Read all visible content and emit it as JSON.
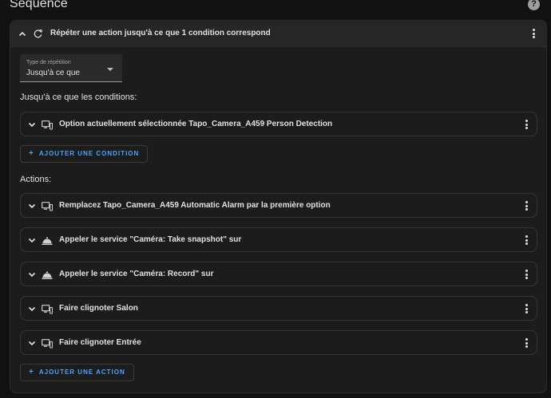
{
  "page": {
    "title": "Séquence",
    "help_icon": "help-circle-icon"
  },
  "repeat_block": {
    "title": "Répéter une action jusqu'à ce que 1 condition correspond",
    "icon": "refresh-icon",
    "repeat_type": {
      "label": "Type de répétition",
      "value": "Jusqu'à ce que"
    },
    "conditions_label": "Jusqu'à ce que les conditions:",
    "conditions": [
      {
        "label": "Option actuellement sélectionnée Tapo_Camera_A459 Person Detection",
        "icon": "device-icon"
      }
    ],
    "add_condition_label": "AJOUTER UNE CONDITION",
    "actions_label": "Actions:",
    "actions": [
      {
        "label": "Remplacez Tapo_Camera_A459 Automatic Alarm par la première option",
        "icon": "device-icon"
      },
      {
        "label": "Appeler le service \"Caméra: Take snapshot\" sur",
        "icon": "service-bell-icon"
      },
      {
        "label": "Appeler le service \"Caméra: Record\" sur",
        "icon": "service-bell-icon"
      },
      {
        "label": "Faire clignoter Salon",
        "icon": "device-icon"
      },
      {
        "label": "Faire clignoter Entrée",
        "icon": "device-icon"
      }
    ],
    "add_action_label": "AJOUTER UNE ACTION"
  },
  "colors": {
    "accent": "#4aa3ff",
    "background": "#111111",
    "card": "#1c1c1c",
    "text": "#e1e1e1"
  }
}
